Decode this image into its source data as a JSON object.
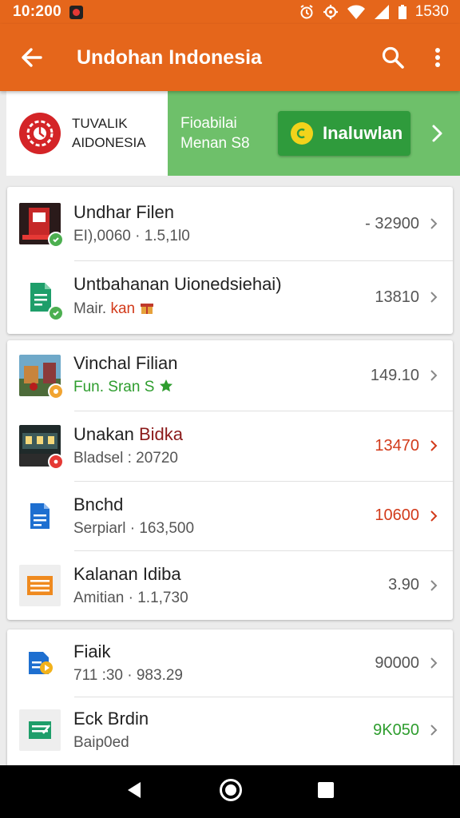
{
  "status_bar": {
    "time": "10:200",
    "battery": "1530"
  },
  "app_bar": {
    "title": "Undohan Indonesia"
  },
  "banner": {
    "brand_line1": "TUVALIK",
    "brand_line2": "AIDONESIA",
    "promo_line1": "Fioabilai",
    "promo_line2": "Menan S8",
    "cta_label": "Inaluwlan"
  },
  "cards": [
    {
      "rows": [
        {
          "title": "Undhar Filen",
          "subtitle": "EI),0060 · 1.5,1l0",
          "value": "- 32900"
        },
        {
          "title": "Untbahanan Uionedsiehai)",
          "subtitle_main": "Mair.",
          "subtitle_accent": "kan",
          "value": "13810"
        }
      ]
    },
    {
      "rows": [
        {
          "title": "Vinchal Filian",
          "subtitle": "Fun. Sran S",
          "value": "149.10"
        },
        {
          "title_main": "Unakan",
          "title_accent": "Bidka",
          "subtitle": "Bladsel : 20720",
          "value": "13470"
        },
        {
          "title": "Bnchd",
          "subtitle": "Serpiarl · 163,500",
          "value": "10600"
        },
        {
          "title": "Kalanan Idiba",
          "subtitle": "Amitian · 1.1,730",
          "value": "3.90"
        }
      ]
    },
    {
      "rows": [
        {
          "title": "Fiaik",
          "subtitle": "711 :30 · 983.29",
          "value": "90000"
        },
        {
          "title": "Eck Brdin",
          "subtitle": "Baip0ed",
          "value": "9K050"
        }
      ]
    }
  ],
  "icons": {
    "back": "arrow-left-icon",
    "search": "search-icon",
    "more": "more-vert-icon",
    "chevron": "chevron-right-icon"
  },
  "colors": {
    "app_bar": "#e5661b",
    "banner": "#6ec06a",
    "cta": "#2f9b3c",
    "value_red": "#d23a1a",
    "value_green": "#2e9d2e",
    "subtitle_green": "#2e9d2e"
  }
}
